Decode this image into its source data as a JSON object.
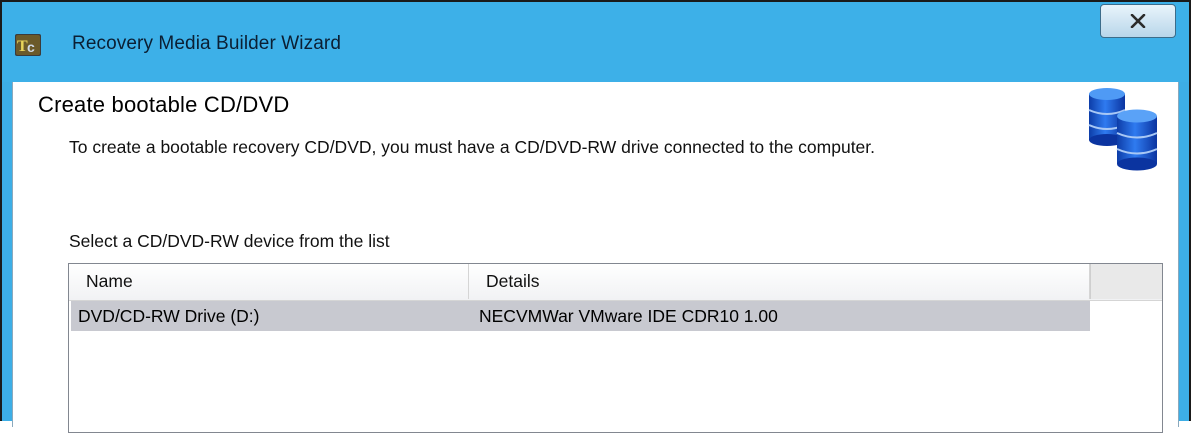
{
  "window": {
    "title": "Recovery Media Builder Wizard",
    "app_icon": "tc-app-icon",
    "close_glyph": "X"
  },
  "page": {
    "title": "Create bootable CD/DVD",
    "description": "To create a bootable recovery CD/DVD, you must have a CD/DVD-RW drive connected to the computer.",
    "header_icon": "database-icon",
    "select_label": "Select a CD/DVD-RW device from the list"
  },
  "device_list": {
    "columns": [
      "Name",
      "Details"
    ],
    "rows": [
      {
        "name": "DVD/CD-RW Drive (D:)",
        "details": "NECVMWar VMware IDE CDR10 1.00",
        "selected": true
      }
    ]
  },
  "colors": {
    "titlebar": "#3db0e8",
    "selected_row": "#c8c9d0",
    "db_icon_blue": "#1f5fd1"
  }
}
